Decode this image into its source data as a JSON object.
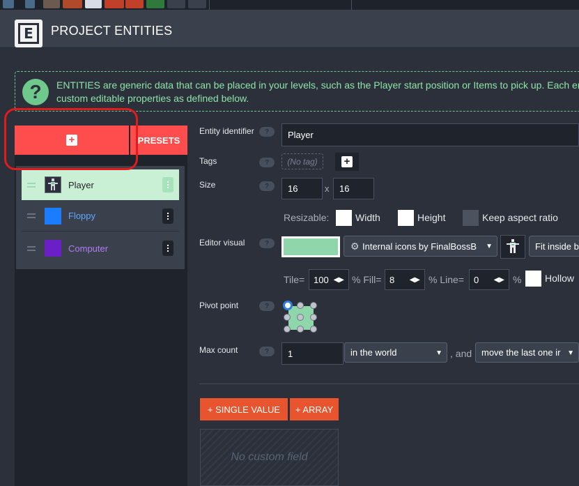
{
  "header": {
    "title": "PROJECT ENTITIES",
    "logo_letter": "E"
  },
  "info": {
    "text_line1": "ENTITIES are generic data that can be placed in your levels, such as the Player start position or Items to pick up. Each entity",
    "text_line2": "custom editable properties as defined below."
  },
  "left": {
    "add_icon": "+",
    "presets_label": "PRESETS",
    "entities": [
      {
        "name": "Player",
        "color": "#2b303b",
        "selected": true,
        "text_color": "#1f232b"
      },
      {
        "name": "Floppy",
        "color": "#1a7cff",
        "selected": false,
        "text_color": "#5fa8ff"
      },
      {
        "name": "Computer",
        "color": "#6a1fc7",
        "selected": false,
        "text_color": "#b07df0"
      }
    ]
  },
  "form": {
    "identifier_label": "Entity identifier",
    "identifier_value": "Player",
    "tags_label": "Tags",
    "tags_empty": "(No tag)",
    "size_label": "Size",
    "width_value": "16",
    "times": "x",
    "height_value": "16",
    "resizable_label": "Resizable:",
    "width_label": "Width",
    "height_label": "Height",
    "keep_aspect_label": "Keep aspect ratio",
    "editor_visual_label": "Editor visual",
    "color_value": "#8fd6aa",
    "icon_source": "Internal icons by FinalBossB",
    "fit_option": "Fit inside b",
    "tile_label": "Tile=",
    "tile_value": "100",
    "fill_label": "% Fill=",
    "fill_value": "8",
    "line_label": "% Line=",
    "line_value": "0",
    "percent": "%",
    "hollow_label": "Hollow",
    "pivot_label": "Pivot point",
    "maxcount_label": "Max count",
    "maxcount_value": "1",
    "scope_option": "in the world",
    "and_label": ", and",
    "behavior_option": "move the last one ir",
    "single_value_btn": "+ SINGLE VALUE",
    "array_btn": "+ ARRAY",
    "no_field": "No custom field",
    "help_glyph": "?"
  }
}
